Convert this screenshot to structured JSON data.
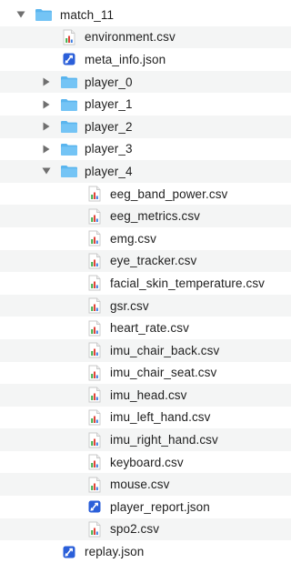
{
  "tree": [
    {
      "label": "match_11",
      "type": "folder",
      "depth": 0,
      "expanded": true,
      "icon": "folder-icon"
    },
    {
      "label": "environment.csv",
      "type": "csv",
      "depth": 1,
      "icon": "csv-file-icon"
    },
    {
      "label": "meta_info.json",
      "type": "json",
      "depth": 1,
      "icon": "json-file-icon"
    },
    {
      "label": "player_0",
      "type": "folder",
      "depth": 1,
      "expanded": false,
      "icon": "folder-icon"
    },
    {
      "label": "player_1",
      "type": "folder",
      "depth": 1,
      "expanded": false,
      "icon": "folder-icon"
    },
    {
      "label": "player_2",
      "type": "folder",
      "depth": 1,
      "expanded": false,
      "icon": "folder-icon"
    },
    {
      "label": "player_3",
      "type": "folder",
      "depth": 1,
      "expanded": false,
      "icon": "folder-icon"
    },
    {
      "label": "player_4",
      "type": "folder",
      "depth": 1,
      "expanded": true,
      "icon": "folder-icon"
    },
    {
      "label": "eeg_band_power.csv",
      "type": "csv",
      "depth": 2,
      "icon": "csv-file-icon"
    },
    {
      "label": "eeg_metrics.csv",
      "type": "csv",
      "depth": 2,
      "icon": "csv-file-icon"
    },
    {
      "label": "emg.csv",
      "type": "csv",
      "depth": 2,
      "icon": "csv-file-icon"
    },
    {
      "label": "eye_tracker.csv",
      "type": "csv",
      "depth": 2,
      "icon": "csv-file-icon"
    },
    {
      "label": "facial_skin_temperature.csv",
      "type": "csv",
      "depth": 2,
      "icon": "csv-file-icon"
    },
    {
      "label": "gsr.csv",
      "type": "csv",
      "depth": 2,
      "icon": "csv-file-icon"
    },
    {
      "label": "heart_rate.csv",
      "type": "csv",
      "depth": 2,
      "icon": "csv-file-icon"
    },
    {
      "label": "imu_chair_back.csv",
      "type": "csv",
      "depth": 2,
      "icon": "csv-file-icon"
    },
    {
      "label": "imu_chair_seat.csv",
      "type": "csv",
      "depth": 2,
      "icon": "csv-file-icon"
    },
    {
      "label": "imu_head.csv",
      "type": "csv",
      "depth": 2,
      "icon": "csv-file-icon"
    },
    {
      "label": "imu_left_hand.csv",
      "type": "csv",
      "depth": 2,
      "icon": "csv-file-icon"
    },
    {
      "label": "imu_right_hand.csv",
      "type": "csv",
      "depth": 2,
      "icon": "csv-file-icon"
    },
    {
      "label": "keyboard.csv",
      "type": "csv",
      "depth": 2,
      "icon": "csv-file-icon"
    },
    {
      "label": "mouse.csv",
      "type": "csv",
      "depth": 2,
      "icon": "csv-file-icon"
    },
    {
      "label": "player_report.json",
      "type": "json",
      "depth": 2,
      "icon": "json-file-icon"
    },
    {
      "label": "spo2.csv",
      "type": "csv",
      "depth": 2,
      "icon": "csv-file-icon"
    },
    {
      "label": "replay.json",
      "type": "json",
      "depth": 1,
      "icon": "json-file-icon"
    }
  ],
  "colors": {
    "folder": "#5ab5ee",
    "folder_tab": "#74c4f5",
    "stripe": "#f4f5f5",
    "json_badge": "#2b5fd9",
    "csv_bar_green": "#3fae49",
    "csv_bar_red": "#e2433a",
    "csv_bar_blue": "#3b7de0",
    "disclosure": "#6f6f6f",
    "text": "#1e1e1e"
  }
}
